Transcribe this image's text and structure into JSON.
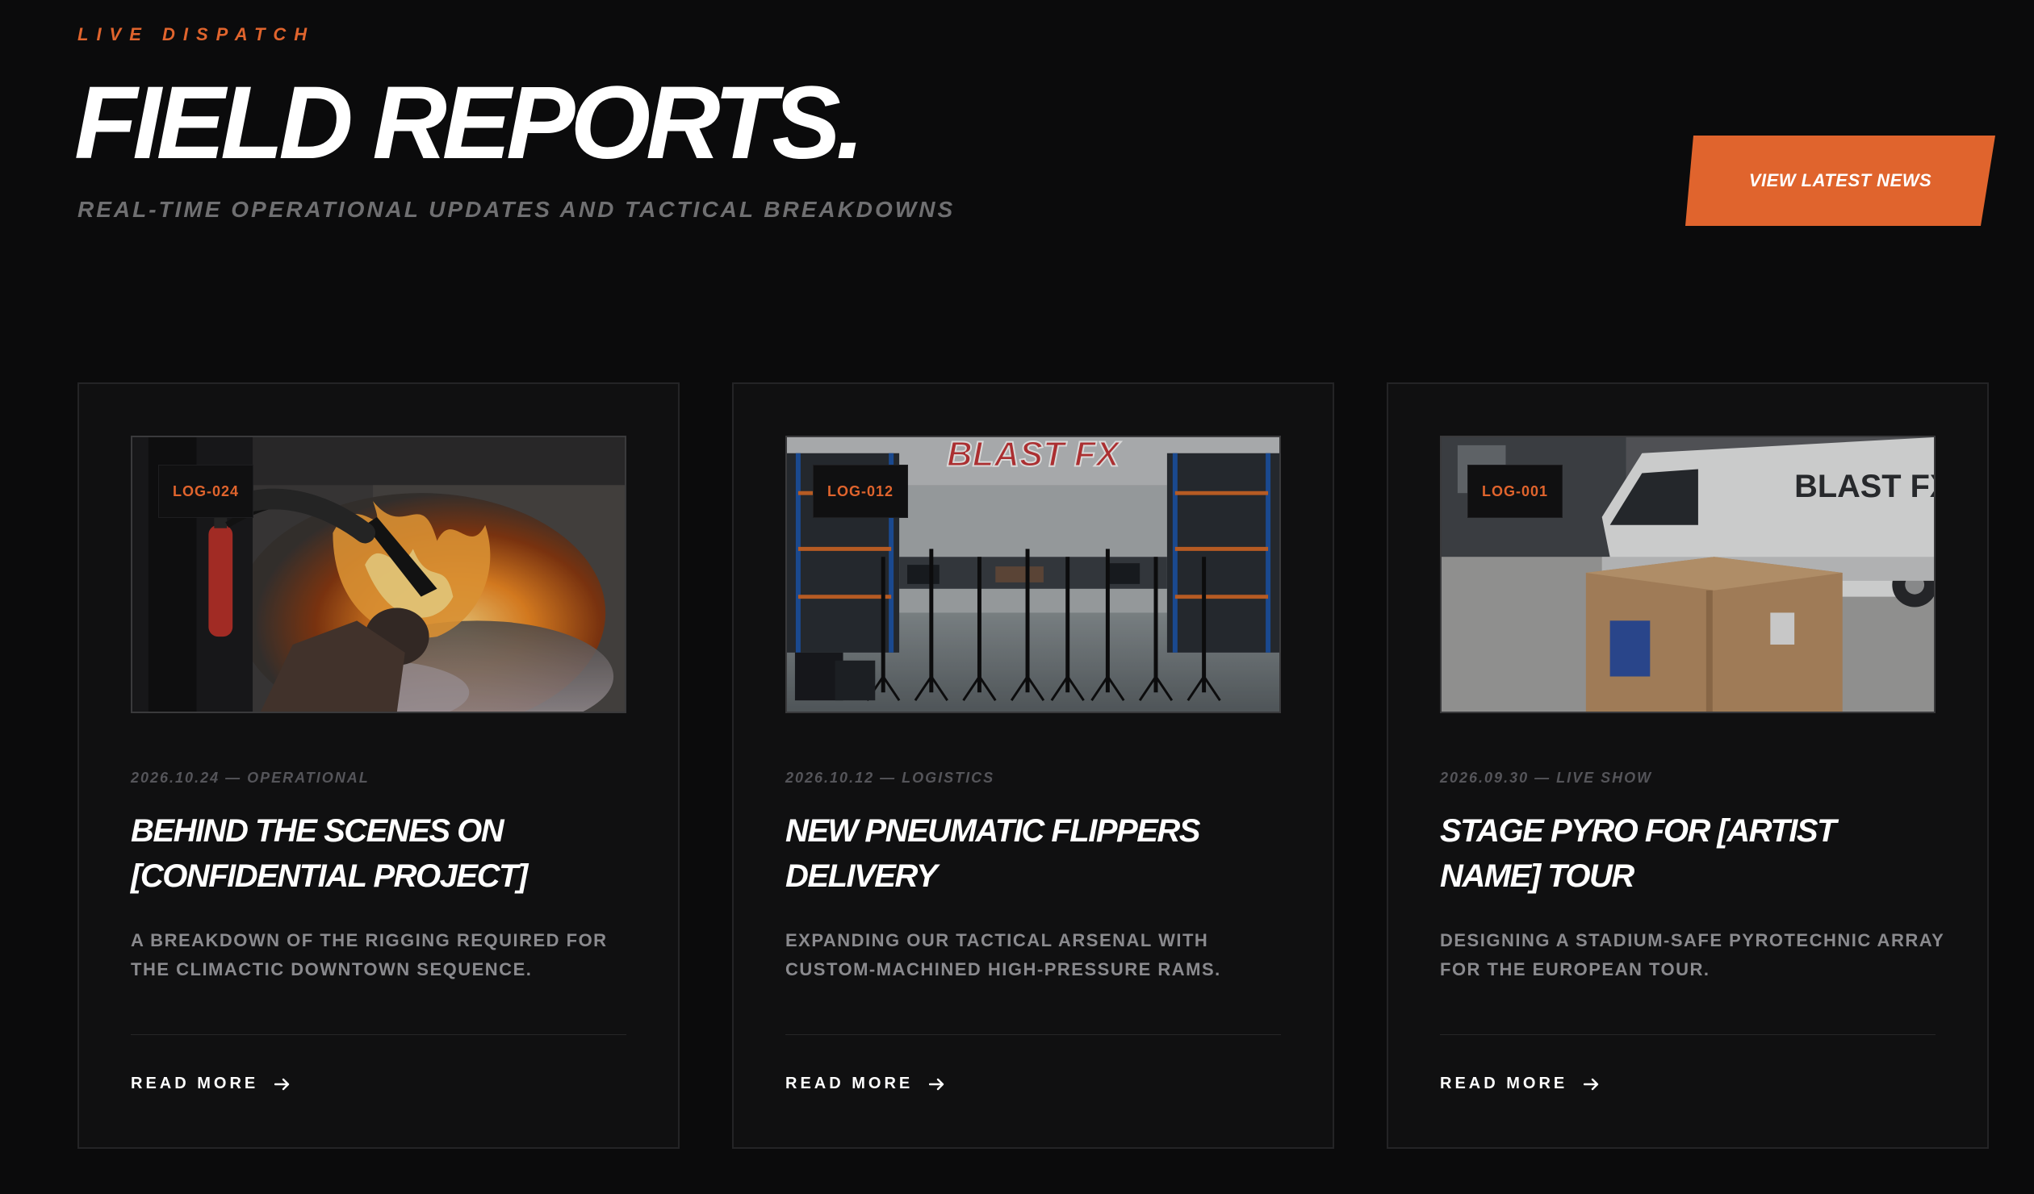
{
  "header": {
    "eyebrow": "LIVE DISPATCH",
    "title": "FIELD REPORTS.",
    "subtitle": "REAL-TIME OPERATIONAL UPDATES AND TACTICAL BREAKDOWNS",
    "cta_label": "VIEW LATEST NEWS"
  },
  "colors": {
    "background": "#0b0b0c",
    "card": "#101011",
    "accent": "#e0642d",
    "muted": "#8a8a8e"
  },
  "cards": [
    {
      "log": "LOG-024",
      "meta": "2026.10.24 — OPERATIONAL",
      "title": "BEHIND THE SCENES ON [CONFIDENTIAL PROJECT]",
      "description": "A BREAKDOWN OF THE RIGGING REQUIRED FOR THE CLIMACTIC DOWNTOWN SEQUENCE.",
      "link": "READ MORE",
      "image": "fire-stunt-photo"
    },
    {
      "log": "LOG-012",
      "meta": "2026.10.12 — LOGISTICS",
      "title": "NEW PNEUMATIC FLIPPERS DELIVERY",
      "description": "EXPANDING OUR TACTICAL ARSENAL WITH CUSTOM-MACHINED HIGH-PRESSURE RAMS.",
      "link": "READ MORE",
      "image": "warehouse-photo",
      "image_sign": "BLAST FX"
    },
    {
      "log": "LOG-001",
      "meta": "2026.09.30 — LIVE SHOW",
      "title": "STAGE PYRO FOR [ARTIST NAME] TOUR",
      "description": "DESIGNING A STADIUM-SAFE PYROTECHNIC ARRAY FOR THE EUROPEAN TOUR.",
      "link": "READ MORE",
      "image": "van-and-boxes-photo",
      "image_sign": "BLAST FX"
    }
  ]
}
